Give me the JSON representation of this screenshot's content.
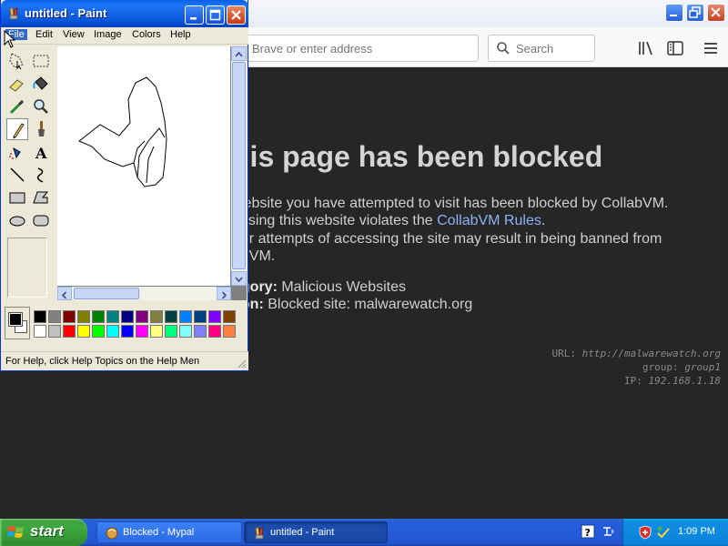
{
  "browser": {
    "address_placeholder": "Brave or enter address",
    "search_placeholder": "Search",
    "page": {
      "title": "his page has been blocked",
      "line1": "website you have attempted to visit has been blocked by CollabVM.",
      "line2_prefix": "essing this website violates the ",
      "rules_link": "CollabVM Rules",
      "line2_suffix": ".",
      "line3": "her attempts of accessing the site may result in being banned from",
      "line4": "abVM.",
      "category_label": "egory:",
      "category_value": " Malicious Websites",
      "reason_label": "son:",
      "reason_value": " Blocked site: malwarewatch.org",
      "meta_url_label": "URL: ",
      "meta_url_value": "http://malwarewatch.org",
      "meta_group_label": "group: ",
      "meta_group_value": "group1",
      "meta_ip_label": "IP: ",
      "meta_ip_value": "192.168.1.18"
    }
  },
  "paint": {
    "title": "untitled - Paint",
    "menu": {
      "file": "File",
      "edit": "Edit",
      "view": "View",
      "image": "Image",
      "colors": "Colors",
      "help": "Help"
    },
    "status": "For Help, click Help Topics on the Help Men",
    "palette_top": [
      "#000000",
      "#808080",
      "#800000",
      "#808000",
      "#008000",
      "#008080",
      "#000080",
      "#800080",
      "#808040",
      "#004040",
      "#0080ff",
      "#004080",
      "#8000ff",
      "#804000"
    ],
    "palette_bottom": [
      "#ffffff",
      "#c0c0c0",
      "#ff0000",
      "#ffff00",
      "#00ff00",
      "#00ffff",
      "#0000ff",
      "#ff00ff",
      "#ffff80",
      "#00ff80",
      "#80ffff",
      "#8080ff",
      "#ff0080",
      "#ff8040"
    ]
  },
  "taskbar": {
    "start": "start",
    "task_browser": "Blocked - Mypal",
    "task_paint": "untitled - Paint",
    "clock": "1:09 PM"
  }
}
